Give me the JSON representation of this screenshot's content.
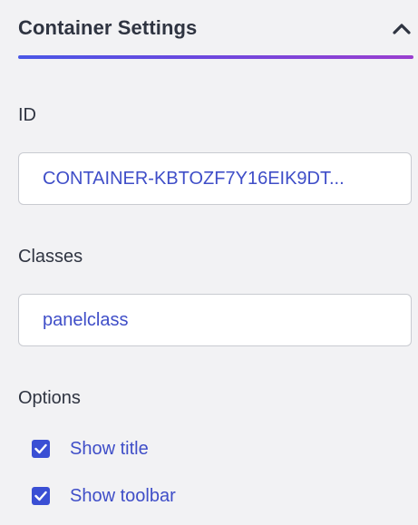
{
  "section": {
    "title": "Container Settings",
    "collapse_icon": "chevron-up-icon",
    "accent_gradient": [
      "#4a57e6",
      "#9a3fcf"
    ]
  },
  "fields": {
    "id": {
      "label": "ID",
      "value": "CONTAINER-KBTOZF7Y16EIK9DT..."
    },
    "classes": {
      "label": "Classes",
      "value": "panelclass"
    }
  },
  "options": {
    "label": "Options",
    "items": [
      {
        "label": "Show title",
        "checked": true,
        "icon": "checkbox-checked-icon"
      },
      {
        "label": "Show toolbar",
        "checked": true,
        "icon": "checkbox-checked-icon"
      }
    ]
  },
  "colors": {
    "text": "#2f3441",
    "accent": "#3a4fd4",
    "value_text": "#3f4ec8",
    "field_border": "#c9cbd1",
    "background": "#f2f2f4"
  }
}
